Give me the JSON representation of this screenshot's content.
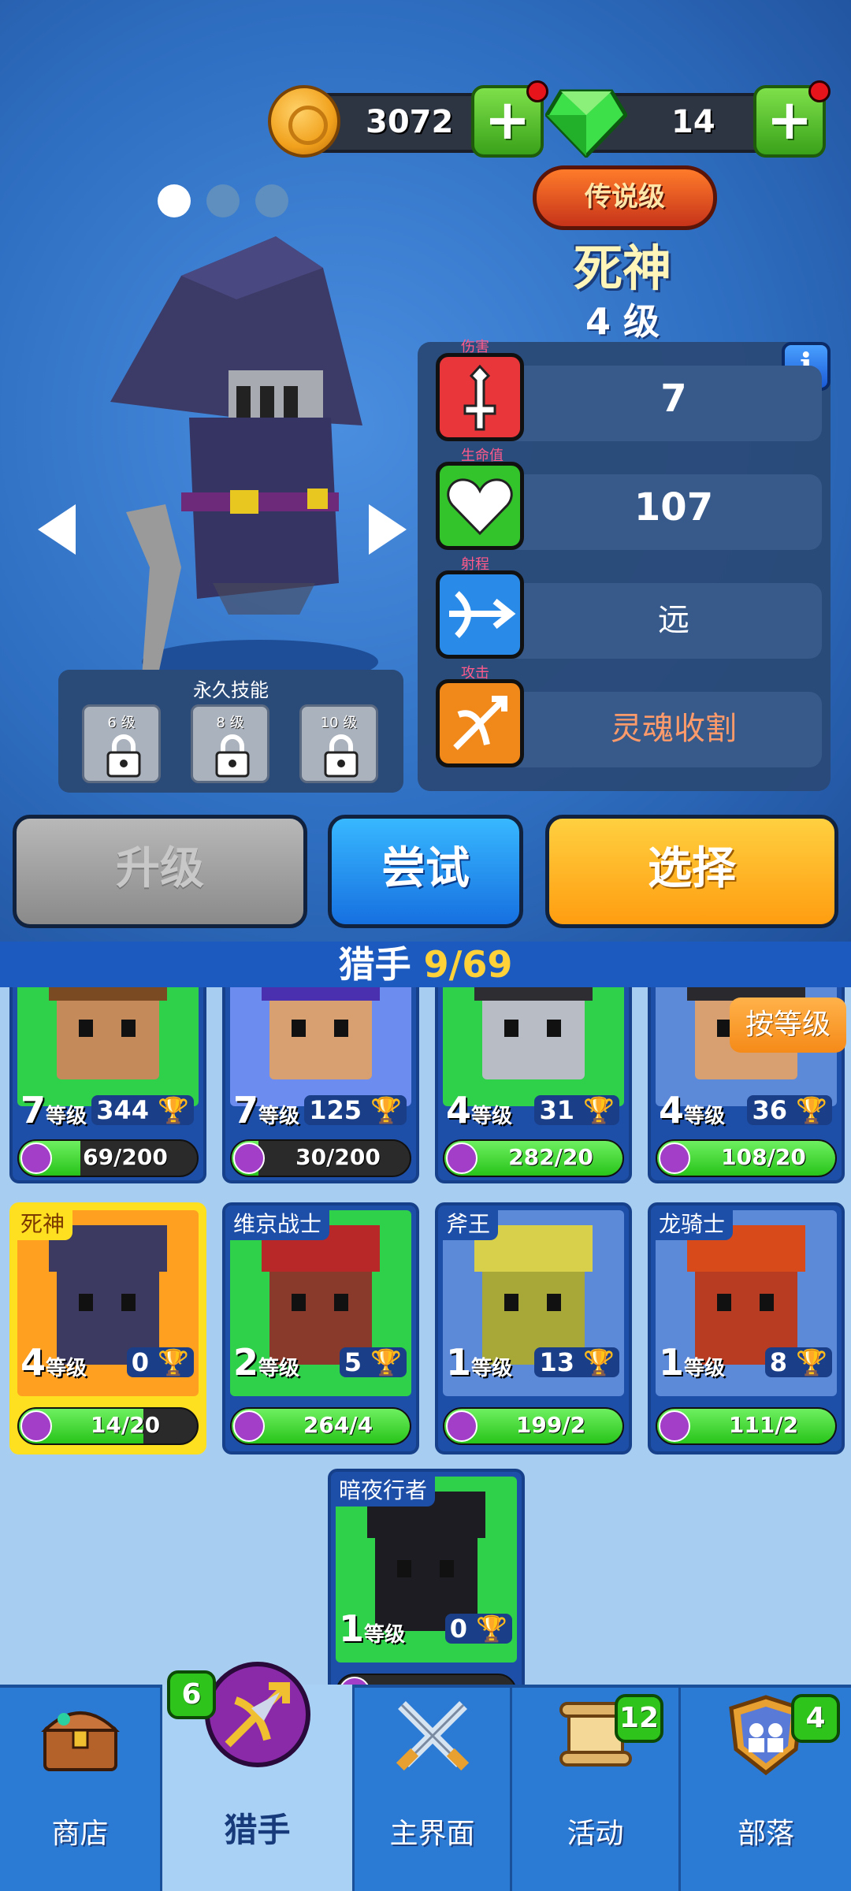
{
  "currency": {
    "coins": "3072",
    "gems": "14",
    "add_label": "+"
  },
  "hero": {
    "rarity": "传说级",
    "name": "死神",
    "level": "4 级"
  },
  "stats": [
    {
      "caption": "伤害",
      "value": "7",
      "color": "#e8363a",
      "icon": "sword-icon"
    },
    {
      "caption": "生命值",
      "value": "107",
      "color": "#33c32a",
      "icon": "heart-icon"
    },
    {
      "caption": "射程",
      "value": "远",
      "color": "#2a8ae8",
      "icon": "crossbow-icon"
    },
    {
      "caption": "攻击",
      "value": "灵魂收割",
      "color": "#f0881a",
      "icon": "bow-arrow-icon"
    }
  ],
  "info_label": "i",
  "permanent_skills": {
    "title": "永久技能",
    "slots": [
      "6 级",
      "8 级",
      "10 级"
    ]
  },
  "actions": {
    "upgrade": "升级",
    "try": "尝试",
    "select": "选择"
  },
  "list": {
    "title": "猎手 ",
    "count": "9/69",
    "sort_label": "按等级"
  },
  "level_suffix": "等级",
  "cards": [
    {
      "name": "",
      "level": "7",
      "trophies": "344",
      "progress": "69/200",
      "fill": 0.345,
      "art": "#2fd04a",
      "face": "#c48a5a",
      "hair": "#7a4a22"
    },
    {
      "name": "",
      "level": "7",
      "trophies": "125",
      "progress": "30/200",
      "fill": 0.15,
      "art": "#6c8cf0",
      "face": "#d8a070",
      "hair": "#4a2fae"
    },
    {
      "name": "",
      "level": "4",
      "trophies": "31",
      "progress": "282/20",
      "fill": 1,
      "art": "#2fd04a",
      "face": "#b8bcc4",
      "hair": "#2e2e32"
    },
    {
      "name": "",
      "level": "4",
      "trophies": "36",
      "progress": "108/20",
      "fill": 1,
      "art": "#5c8ad8",
      "face": "#d8a070",
      "hair": "#2a2a2e"
    },
    {
      "name": "死神",
      "level": "4",
      "trophies": "0",
      "progress": "14/20",
      "fill": 0.7,
      "art": "#ffa020",
      "face": "#3c3a60",
      "hair": "#3c3a60",
      "selected": true
    },
    {
      "name": "维京战士",
      "level": "2",
      "trophies": "5",
      "progress": "264/4",
      "fill": 1,
      "art": "#2fd04a",
      "face": "#8a3a2a",
      "hair": "#b82828"
    },
    {
      "name": "斧王",
      "level": "1",
      "trophies": "13",
      "progress": "199/2",
      "fill": 1,
      "art": "#5c8ad8",
      "face": "#a8a838",
      "hair": "#d8d04a"
    },
    {
      "name": "龙骑士",
      "level": "1",
      "trophies": "8",
      "progress": "111/2",
      "fill": 1,
      "art": "#5c8ad8",
      "face": "#b83c22",
      "hair": "#d84a1a"
    },
    {
      "name": "暗夜行者",
      "level": "1",
      "trophies": "0",
      "progress": "",
      "fill": 0,
      "art": "#2fd04a",
      "face": "#1c1c22",
      "hair": "#1c1c22"
    }
  ],
  "nav": [
    {
      "label": "商店",
      "badge": "",
      "icon": "treasure-chest-icon"
    },
    {
      "label": "猎手",
      "badge": "6",
      "icon": "crossbow-icon"
    },
    {
      "label": "主界面",
      "badge": "",
      "icon": "crossed-swords-icon"
    },
    {
      "label": "活动",
      "badge": "12",
      "icon": "scroll-icon"
    },
    {
      "label": "部落",
      "badge": "4",
      "icon": "clan-shield-icon"
    }
  ]
}
